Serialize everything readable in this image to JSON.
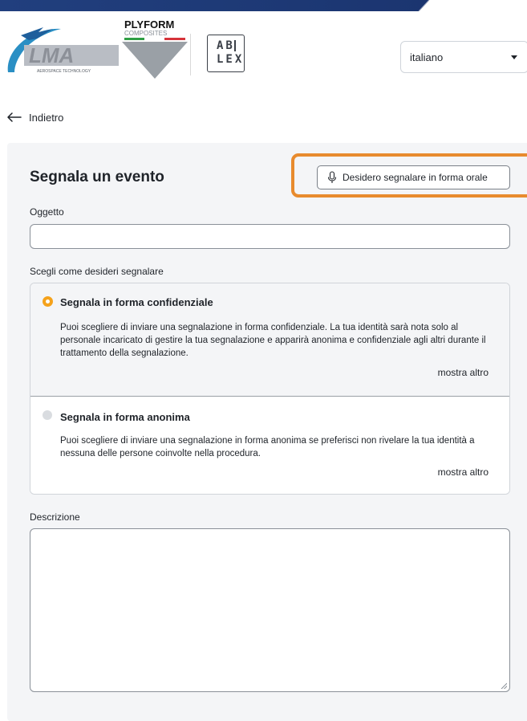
{
  "header": {
    "logo_lma": "LMA",
    "logo_lma_tagline": "AEROSPACE TECHNOLOGY",
    "logo_plyform_name": "PLYFORM",
    "logo_plyform_sub": "COMPOSITES",
    "logo_ablex_row1": "AB",
    "logo_ablex_row2": "LEX",
    "language_value": "italiano"
  },
  "nav": {
    "back_label": "Indietro"
  },
  "form": {
    "title": "Segnala un evento",
    "oral_button_label": "Desidero segnalare in forma orale",
    "subject_label": "Oggetto",
    "subject_value": "",
    "mode_label": "Scegli come desideri segnalare",
    "options": [
      {
        "title": "Segnala in forma confidenziale",
        "description": "Puoi scegliere di inviare una segnalazione in forma confidenziale. La tua identità sarà nota solo al personale incaricato di gestire la tua segnalazione e apparirà anonima e confidenziale agli altri durante il trattamento della segnalazione.",
        "more_label": "mostra altro",
        "selected": true
      },
      {
        "title": "Segnala in forma anonima",
        "description": "Puoi scegliere di inviare una segnalazione in forma anonima se preferisci non rivelare la tua identità a nessuna delle persone coinvolte nella procedura.",
        "more_label": "mostra altro",
        "selected": false
      }
    ],
    "description_label": "Descrizione",
    "description_value": ""
  },
  "colors": {
    "top_bar": "#1e3a78",
    "highlight_outline": "#e88b2e",
    "radio_selected": "#f5a21b",
    "panel_background": "#f4f5f7"
  }
}
